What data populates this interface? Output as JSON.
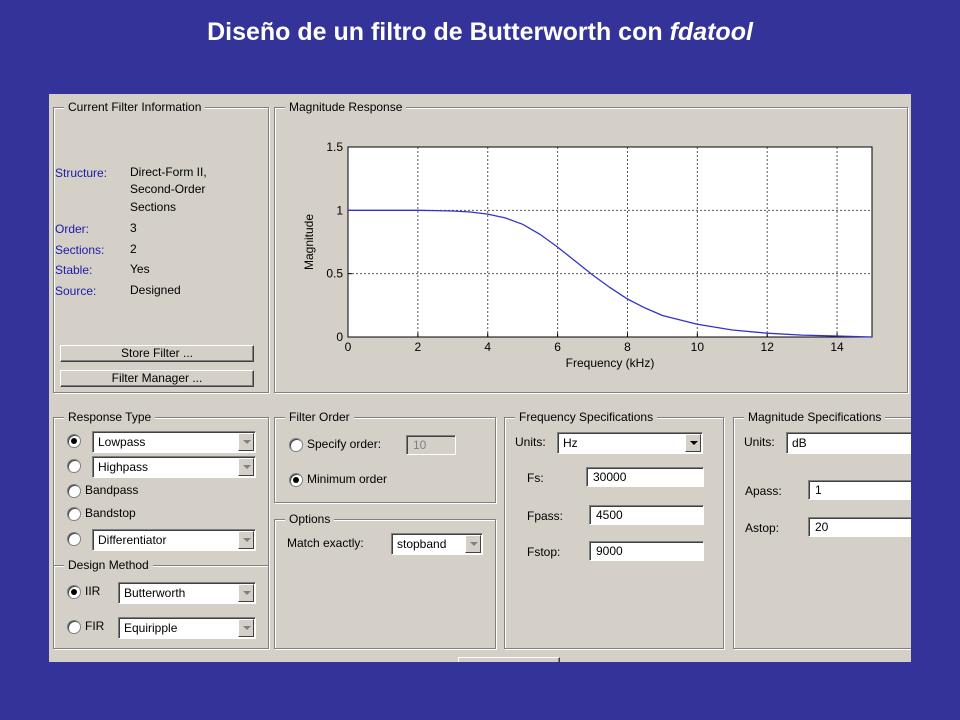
{
  "slide": {
    "title_plain": "Diseño de un filtro de Butterworth con",
    "title_italic": "fdatool"
  },
  "current_filter_info": {
    "title": "Current Filter Information",
    "fields": [
      {
        "label": "Structure:",
        "value": "Direct-Form II,"
      },
      {
        "label": "",
        "value": "Second-Order"
      },
      {
        "label": "",
        "value": "Sections"
      },
      {
        "label": "Order:",
        "value": "3"
      },
      {
        "label": "Sections:",
        "value": "2"
      },
      {
        "label": "Stable:",
        "value": "Yes"
      },
      {
        "label": "Source:",
        "value": "Designed"
      }
    ],
    "store_button": "Store Filter ...",
    "manager_button": "Filter Manager ..."
  },
  "magnitude_panel": {
    "title": "Magnitude Response"
  },
  "chart_data": {
    "type": "line",
    "title": "",
    "xlabel": "Frequency (kHz)",
    "ylabel": "Magnitude",
    "xlim": [
      0,
      15
    ],
    "ylim": [
      0,
      1.5
    ],
    "x_ticks": [
      "0",
      "2",
      "4",
      "6",
      "8",
      "10",
      "12",
      "14"
    ],
    "y_ticks": [
      "0",
      "0.5",
      "1",
      "1.5"
    ],
    "grid": true,
    "series": [
      {
        "color": "#3333cc",
        "x": [
          0,
          1,
          2,
          2.5,
          3,
          3.5,
          4,
          4.5,
          5,
          5.5,
          6,
          6.5,
          7,
          7.5,
          8,
          8.5,
          9,
          10,
          11,
          12,
          13,
          14,
          15
        ],
        "y": [
          1.0,
          1.0,
          1.0,
          0.998,
          0.995,
          0.987,
          0.97,
          0.94,
          0.89,
          0.81,
          0.71,
          0.6,
          0.49,
          0.39,
          0.3,
          0.23,
          0.17,
          0.1,
          0.055,
          0.03,
          0.015,
          0.008,
          0.0
        ]
      }
    ]
  },
  "response_type": {
    "title": "Response Type",
    "options": [
      "Lowpass",
      "Highpass",
      "Bandpass",
      "Bandstop",
      "Differentiator"
    ]
  },
  "design_method": {
    "title": "Design Method",
    "iir_label": "IIR",
    "iir_value": "Butterworth",
    "fir_label": "FIR",
    "fir_value": "Equiripple"
  },
  "filter_order": {
    "title": "Filter Order",
    "specify_label": "Specify order:",
    "specify_value": "10",
    "minimum_label": "Minimum order"
  },
  "options": {
    "title": "Options",
    "match_label": "Match exactly:",
    "match_value": "stopband"
  },
  "freq_specs": {
    "title": "Frequency Specifications",
    "units_label": "Units:",
    "units_value": "Hz",
    "fs_label": "Fs:",
    "fs_value": "30000",
    "fpass_label": "Fpass:",
    "fpass_value": "4500",
    "fstop_label": "Fstop:",
    "fstop_value": "9000"
  },
  "mag_specs": {
    "title": "Magnitude Specifications",
    "units_label": "Units:",
    "units_value": "dB",
    "apass_label": "Apass:",
    "apass_value": "1",
    "astop_label": "Astop:",
    "astop_value": "20"
  }
}
